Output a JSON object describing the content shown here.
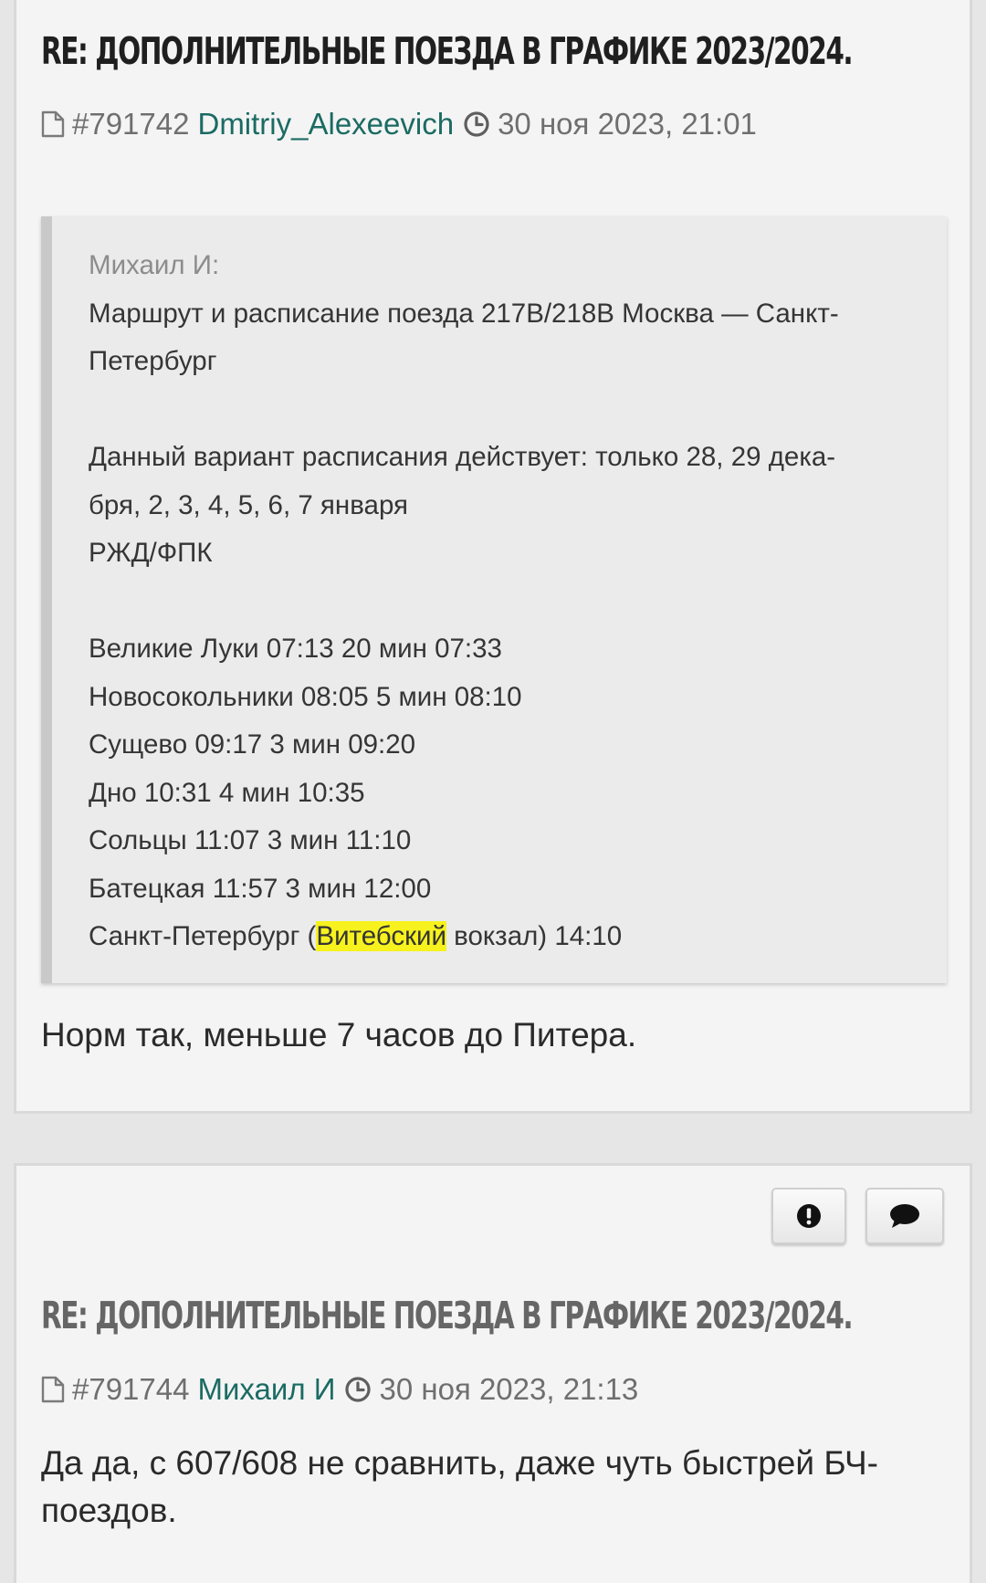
{
  "posts": [
    {
      "title": "RE: ДОПОЛНИТЕЛЬНЫЕ ПОЕЗДА В ГРАФИКЕ 2023/2024.",
      "post_number": "#791742",
      "author": "Dmitriy_Alexeevich",
      "date": "30 ноя 2023, 21:01",
      "quote": {
        "author": "Михаил И:",
        "lines": [
          "Маршрут и расписание поезда 217В/218В Москва — Санкт-",
          "Петербург",
          "",
          "Данный вариант расписания действует: только 28, 29 дека-",
          "бря, 2, 3, 4, 5, 6, 7 января",
          "РЖД/ФПК",
          "",
          "Великие Луки 07:13 20 мин 07:33",
          "Новосокольники 08:05 5 мин 08:10",
          "Сущево 09:17 3 мин 09:20",
          "Дно 10:31 4 мин 10:35",
          "Сольцы 11:07 3 мин 11:10",
          "Батецкая 11:57 3 мин 12:00"
        ],
        "last_line": {
          "before": "Санкт-Петербург (",
          "highlight": "Витебский",
          "after": " вокзал) 14:10"
        }
      },
      "body": "Норм так, меньше 7 часов до Питера."
    },
    {
      "title": "RE: ДОПОЛНИТЕЛЬНЫЕ ПОЕЗДА В ГРАФИКЕ 2023/2024.",
      "post_number": "#791744",
      "author": "Михаил И",
      "date": "30 ноя 2023, 21:13",
      "body": "Да да, с 607/608 не сравнить, даже чуть быстрей БЧ-поездов."
    }
  ],
  "icons": {
    "post_link": "file-icon",
    "time": "clock-icon",
    "report": "exclamation-circle-icon",
    "reply": "speech-bubble-icon"
  },
  "colors": {
    "author_link": "#1b6b63",
    "highlight": "#f7f21d",
    "page_bg": "#e6e6e6",
    "post_bg": "#f4f4f4"
  }
}
